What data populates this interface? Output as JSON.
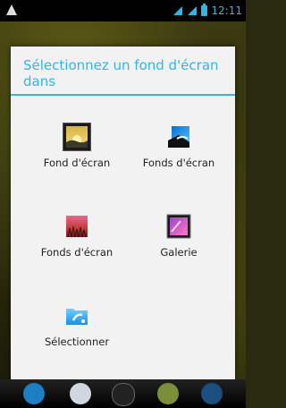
{
  "status": {
    "time": "12:11"
  },
  "dialog": {
    "title": "Sélectionnez un fond d'écran dans",
    "options": [
      {
        "label": "Fond d'écran",
        "icon": "gallery-sunrise-icon"
      },
      {
        "label": "Fonds d'écran",
        "icon": "live-wallpaper-blue-icon"
      },
      {
        "label": "Fonds d'écran",
        "icon": "video-wallpaper-grass-icon"
      },
      {
        "label": "Galerie",
        "icon": "gallery-purple-icon"
      },
      {
        "label": "Sélectionner",
        "icon": "es-file-explorer-icon"
      }
    ]
  },
  "colors": {
    "accent": "#33b5e5",
    "dialog_bg": "#f2f2f2"
  }
}
